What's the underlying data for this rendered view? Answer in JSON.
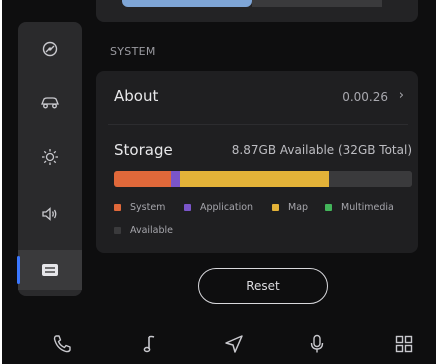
{
  "section": {
    "title": "SYSTEM"
  },
  "about": {
    "label": "About",
    "version": "0.00.26",
    "chevron": "›"
  },
  "storage": {
    "label": "Storage",
    "summary": "8.87GB Available (32GB Total)",
    "segments": [
      {
        "name": "System",
        "color": "#e0683a",
        "fraction": 0.19
      },
      {
        "name": "Application",
        "color": "#7a55c9",
        "fraction": 0.03
      },
      {
        "name": "Map",
        "color": "#e3b238",
        "fraction": 0.5
      },
      {
        "name": "Multimedia",
        "color": "#43b55a",
        "fraction": 0.0
      },
      {
        "name": "Available",
        "color": "#3a3a3c",
        "fraction": 0.28
      }
    ],
    "legend": {
      "system": "System",
      "application": "Application",
      "map": "Map",
      "multimedia": "Multimedia",
      "available": "Available"
    }
  },
  "reset_label": "Reset",
  "sidebar": {
    "items": [
      "steering-wheel-icon",
      "car-icon",
      "brightness-icon",
      "volume-icon",
      "settings-card-icon"
    ],
    "active_index": 4
  },
  "dock": {
    "items": [
      "phone-icon",
      "music-note-icon",
      "navigation-arrow-icon",
      "microphone-icon",
      "apps-grid-icon"
    ]
  },
  "colors": {
    "accent": "#3b78ff",
    "background": "#0e0e0f",
    "card": "#1f1f21"
  }
}
